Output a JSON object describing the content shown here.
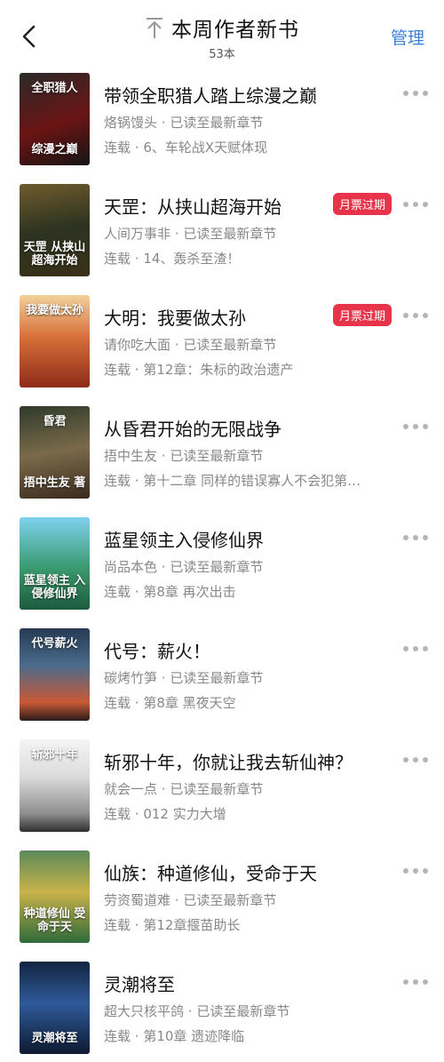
{
  "header": {
    "back_icon": "chevron-left-icon",
    "pin_icon": "pin-top-icon",
    "title": "本周作者新书",
    "count": "53本",
    "manage": "管理"
  },
  "colors": {
    "accent": "#3d7fd6",
    "badge": "#e8344a",
    "secondary_text": "#888888"
  },
  "books": [
    {
      "title": "带领全职猎人踏上综漫之巅",
      "author": "烙锅馒头",
      "status": "已读至最新章节",
      "serial": "连载",
      "latest": "6、车轮战X天赋体现",
      "badge": "",
      "cover_text": "综漫之巅",
      "cover_top": "全职猎人"
    },
    {
      "title": "天罡：从挟山超海开始",
      "author": "人间万事非",
      "status": "已读至最新章节",
      "serial": "连载",
      "latest": "14、轰杀至渣！",
      "badge": "月票过期",
      "cover_text": "天罡 从挟山超海开始",
      "cover_top": ""
    },
    {
      "title": "大明：我要做太孙",
      "author": "请你吃大面",
      "status": "已读至最新章节",
      "serial": "连载",
      "latest": "第12章：朱标的政治遗产",
      "badge": "月票过期",
      "cover_text": "",
      "cover_top": "我要做太孙"
    },
    {
      "title": "从昏君开始的无限战争",
      "author": "捂中生友",
      "status": "已读至最新章节",
      "serial": "连载",
      "latest": "第十二章 同样的错误寡人不会犯第…",
      "badge": "",
      "cover_text": "捂中生友 著",
      "cover_top": "昏君"
    },
    {
      "title": "蓝星领主入侵修仙界",
      "author": "尚品本色",
      "status": "已读至最新章节",
      "serial": "连载",
      "latest": "第8章 再次出击",
      "badge": "",
      "cover_text": "蓝星领主 入侵修仙界",
      "cover_top": ""
    },
    {
      "title": "代号：薪火！",
      "author": "碳烤竹笋",
      "status": "已读至最新章节",
      "serial": "连载",
      "latest": "第8章 黑夜天空",
      "badge": "",
      "cover_text": "",
      "cover_top": "代号薪火"
    },
    {
      "title": "斩邪十年，你就让我去斩仙神？",
      "author": "就会一点",
      "status": "已读至最新章节",
      "serial": "连载",
      "latest": "012 实力大增",
      "badge": "",
      "cover_text": "",
      "cover_top": "斩邪十年"
    },
    {
      "title": "仙族：种道修仙，受命于天",
      "author": "劳资蜀道难",
      "status": "已读至最新章节",
      "serial": "连载",
      "latest": "第12章揠苗助长",
      "badge": "",
      "cover_text": "种道修仙 受命于天",
      "cover_top": ""
    },
    {
      "title": "灵潮将至",
      "author": "超大只核平鸽",
      "status": "已读至最新章节",
      "serial": "连载",
      "latest": "第10章 遗迹降临",
      "badge": "",
      "cover_text": "灵潮将至",
      "cover_top": ""
    }
  ]
}
